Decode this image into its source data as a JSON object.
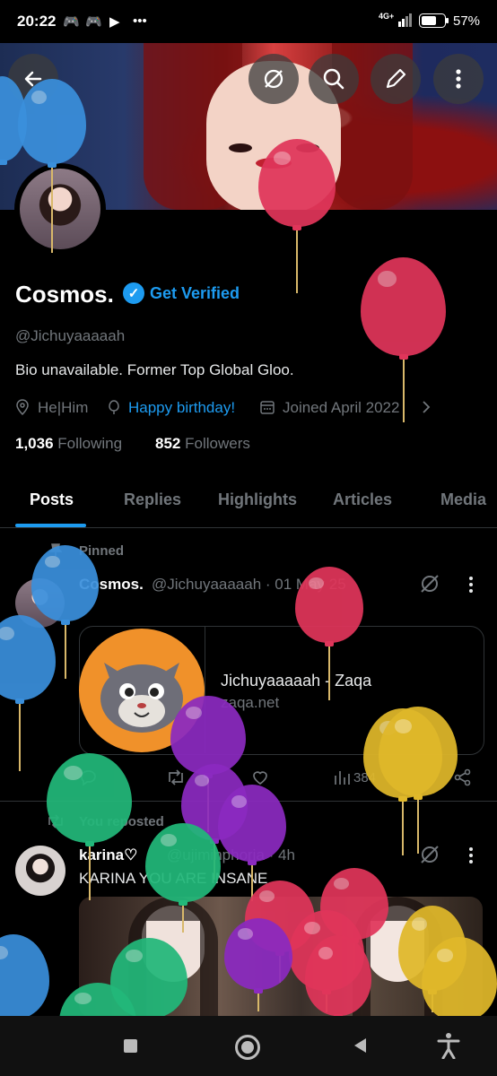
{
  "status_bar": {
    "time": "20:22",
    "battery": "57%",
    "network": "4G+"
  },
  "profile": {
    "name": "Cosmos.",
    "get_verified": "Get Verified",
    "handle": "@Jichuyaaaaah",
    "bio": "Bio unavailable. Former Top Global Gloo.",
    "pronouns": "He|Him",
    "birthday": "Happy birthday!",
    "joined": "Joined April 2022",
    "following_count": "1,036",
    "following_label": "Following",
    "followers_count": "852",
    "followers_label": "Followers"
  },
  "tabs": [
    "Posts",
    "Replies",
    "Highlights",
    "Articles",
    "Media"
  ],
  "pinned_post": {
    "pinned_label": "Pinned",
    "author": "Cosmos.",
    "handle_date": "@Jichuyaaaaah · 01 May 25",
    "card_title": "Jichuyaaaaah - Zaqa",
    "card_domain": "zaqa.net",
    "views": "384"
  },
  "repost": {
    "repost_label": "You reposted",
    "author": "karina♡",
    "handle_time": "@ujiminphoria · 4h",
    "text": "KARINA YOU ARE INSANE"
  },
  "colors": {
    "accent": "#1d9bf0",
    "background": "#000000",
    "secondary_text": "#71767b"
  }
}
